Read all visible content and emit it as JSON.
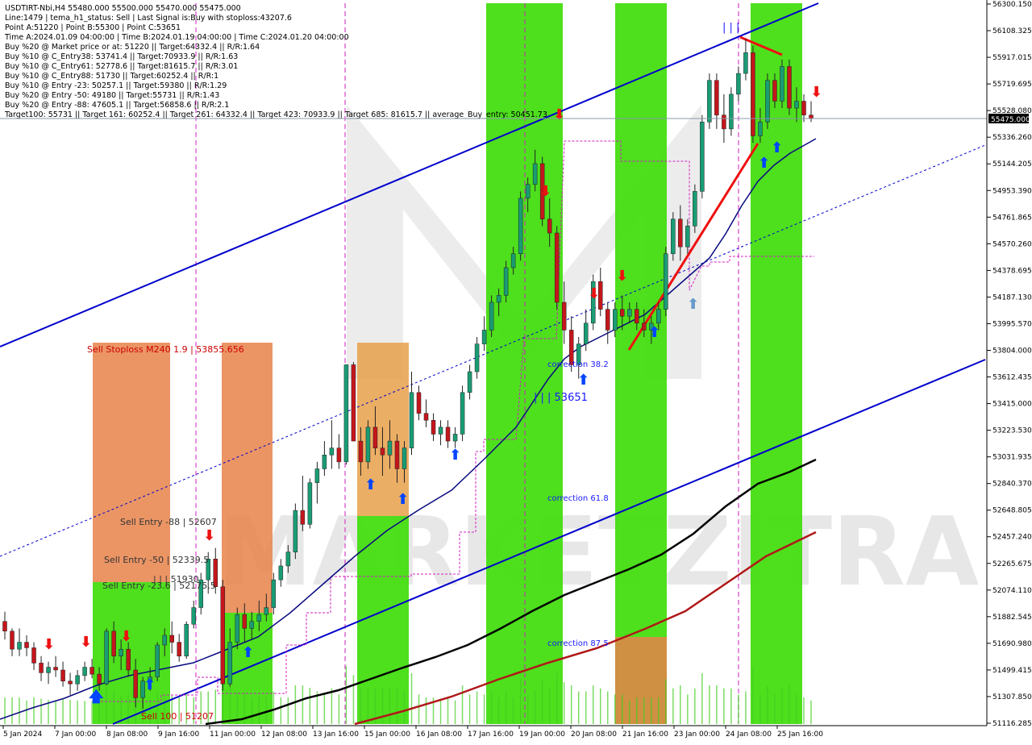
{
  "chart_data": {
    "type": "candlestick",
    "symbol_line": "USDTIRT-Nbi,H4  55480.000 55500.000 55470.000 55475.000",
    "info_lines": [
      "Line:1479 | tema_h1_status: Sell | Last Signal is:Buy with stoploss:43207.6",
      "Point A:51220 | Point B:55300 | Point C:53651",
      "Time A:2024.01.09 04:00:00 | Time B:2024.01.19 04:00:00 | Time C:2024.01.20 04:00:00",
      "Buy %20 @ Market price or at: 51220 || Target:64332.4 || R/R:1.64",
      "Buy %10 @ C_Entry38: 53741.4 || Target:70933.9 || R/R:1.63",
      "Buy %10 @ C_Entry61: 52778.6 || Target:81615.7 || R/R:3.01",
      "Buy %10 @ C_Entry88: 51730 || Target:60252.4 || R/R:1",
      "Buy %10 @ Entry -23: 50257.1 || Target:59380 || R/R:1.29",
      "Buy %20 @ Entry -50: 49180 || Target:55731 || R/R:1.43",
      "Buy %20 @ Entry -88: 47605.1 || Target:56858.6 || R/R:2.1",
      "Target100: 55731 || Target 161: 60252.4 || Target 261: 64332.4 || Target 423: 70933.9 || Target 685: 81615.7 || average_Buy_entry: 50451.73"
    ],
    "y_ticks": [
      "56300.150",
      "56108.325",
      "55917.015",
      "55719.695",
      "55528.080",
      "55336.260",
      "55144.205",
      "54953.390",
      "54761.865",
      "54570.260",
      "54378.695",
      "54187.130",
      "53995.570",
      "53804.000",
      "53612.435",
      "53415.000",
      "53223.530",
      "53031.935",
      "52840.370",
      "52648.805",
      "52457.240",
      "52265.675",
      "52074.110",
      "51882.545",
      "51690.980",
      "51499.415",
      "51307.850",
      "51116.285"
    ],
    "ylim": [
      51116.285,
      56300.15
    ],
    "current_price": "55475.000",
    "x_ticks": [
      "5 Jan 2024",
      "7 Jan 00:00",
      "8 Jan 08:00",
      "9 Jan 16:00",
      "11 Jan 00:00",
      "12 Jan 08:00",
      "13 Jan 16:00",
      "15 Jan 00:00",
      "16 Jan 08:00",
      "17 Jan 16:00",
      "19 Jan 00:00",
      "20 Jan 08:00",
      "21 Jan 16:00",
      "23 Jan 00:00",
      "24 Jan 08:00",
      "25 Jan 16:00"
    ],
    "annotations": {
      "sell_stoploss": "Sell Stoploss M240 1.9 | 53855.656",
      "sell_entry_88": "Sell Entry -88 | 52607",
      "sell_entry_50": "Sell Entry -50 | 52339.5",
      "sell_entry_23": "Sell Entry -23.6 | 52175.5",
      "point_label_low": "| | | 51930",
      "sell_100": "Sell 100 | 51207",
      "correction_38": "correction 38.2",
      "correction_61": "correction 61.8",
      "correction_87": "correction 87.5",
      "point_c": "| | | 53651",
      "point_b": "| | |"
    },
    "watermark": "MARKETZITRADE",
    "colors": {
      "bull": "#1a9c74",
      "bear": "#c4161c",
      "channel": "#0000cc",
      "ma_fast": "#0a0a80",
      "ma_mid": "#000000",
      "ma_slow": "#b01818",
      "green_zone": "#44dd11",
      "orange_zone": "#e8834a",
      "magenta": "#d020c0"
    },
    "candles": [
      [
        51850,
        51920,
        51720,
        51780
      ],
      [
        51780,
        51800,
        51600,
        51650
      ],
      [
        51650,
        51800,
        51600,
        51700
      ],
      [
        51700,
        51750,
        51600,
        51660
      ],
      [
        51660,
        51700,
        51500,
        51550
      ],
      [
        51550,
        51600,
        51420,
        51480
      ],
      [
        51480,
        51560,
        51400,
        51520
      ],
      [
        51520,
        51600,
        51450,
        51500
      ],
      [
        51500,
        51560,
        51380,
        51420
      ],
      [
        51420,
        51480,
        51320,
        51400
      ],
      [
        51400,
        51500,
        51350,
        51460
      ],
      [
        51460,
        51560,
        51420,
        51520
      ],
      [
        51520,
        51580,
        51440,
        51470
      ],
      [
        51470,
        51520,
        51350,
        51400
      ],
      [
        51400,
        51800,
        51390,
        51780
      ],
      [
        51780,
        51850,
        51550,
        51600
      ],
      [
        51600,
        51720,
        51500,
        51650
      ],
      [
        51650,
        51700,
        51450,
        51500
      ],
      [
        51500,
        51580,
        51230,
        51300
      ],
      [
        51300,
        51450,
        51220,
        51420
      ],
      [
        51420,
        51520,
        51350,
        51450
      ],
      [
        51450,
        51700,
        51420,
        51680
      ],
      [
        51680,
        51800,
        51600,
        51750
      ],
      [
        51750,
        51850,
        51620,
        51700
      ],
      [
        51700,
        51760,
        51560,
        51600
      ],
      [
        51600,
        51850,
        51580,
        51830
      ],
      [
        51830,
        52000,
        51800,
        51950
      ],
      [
        51950,
        52200,
        51900,
        52150
      ],
      [
        52150,
        52350,
        52050,
        52300
      ],
      [
        52300,
        52380,
        52050,
        52100
      ],
      [
        52100,
        52150,
        51350,
        51400
      ],
      [
        51400,
        51800,
        51380,
        51700
      ],
      [
        51700,
        51950,
        51650,
        51900
      ],
      [
        51900,
        51980,
        51700,
        51800
      ],
      [
        51800,
        51920,
        51720,
        51850
      ],
      [
        51850,
        52000,
        51780,
        51900
      ],
      [
        51900,
        52050,
        51850,
        51950
      ],
      [
        51950,
        52200,
        51900,
        52150
      ],
      [
        52150,
        52300,
        52100,
        52250
      ],
      [
        52250,
        52400,
        52200,
        52350
      ],
      [
        52350,
        52700,
        52300,
        52650
      ],
      [
        52650,
        52900,
        52500,
        52550
      ],
      [
        52550,
        52880,
        52520,
        52850
      ],
      [
        52850,
        53000,
        52700,
        52950
      ],
      [
        52950,
        53150,
        52900,
        53050
      ],
      [
        53050,
        53300,
        52950,
        53100
      ],
      [
        53100,
        53200,
        52950,
        53000
      ],
      [
        53000,
        53700,
        52980,
        53700
      ],
      [
        53700,
        53720,
        53150,
        53150
      ],
      [
        53150,
        53250,
        52900,
        53000
      ],
      [
        53000,
        53300,
        52950,
        53250
      ],
      [
        53250,
        53400,
        53050,
        53100
      ],
      [
        53100,
        53250,
        52900,
        53050
      ],
      [
        53050,
        53300,
        52950,
        53150
      ],
      [
        53150,
        53200,
        52850,
        52950
      ],
      [
        52950,
        53150,
        52850,
        53100
      ],
      [
        53100,
        53650,
        53050,
        53500
      ],
      [
        53500,
        53550,
        53300,
        53350
      ],
      [
        53350,
        53450,
        53250,
        53300
      ],
      [
        53300,
        53350,
        53150,
        53200
      ],
      [
        53200,
        53300,
        53120,
        53250
      ],
      [
        53250,
        53300,
        53100,
        53150
      ],
      [
        53150,
        53250,
        53100,
        53200
      ],
      [
        53200,
        53550,
        53150,
        53500
      ],
      [
        53500,
        53700,
        53450,
        53650
      ],
      [
        53650,
        53900,
        53600,
        53850
      ],
      [
        53850,
        54050,
        53800,
        53950
      ],
      [
        53950,
        54200,
        53900,
        54150
      ],
      [
        54150,
        54250,
        54050,
        54200
      ],
      [
        54200,
        54450,
        54150,
        54400
      ],
      [
        54400,
        54550,
        54350,
        54500
      ],
      [
        54500,
        54950,
        54450,
        54900
      ],
      [
        54900,
        55050,
        54800,
        55000
      ],
      [
        55000,
        55250,
        54950,
        55150
      ],
      [
        55150,
        55200,
        54700,
        54750
      ],
      [
        54750,
        54900,
        54550,
        54650
      ],
      [
        54650,
        54700,
        54100,
        54150
      ],
      [
        54150,
        54300,
        53850,
        53950
      ],
      [
        53950,
        54050,
        53650,
        53700
      ],
      [
        53700,
        53900,
        53600,
        53850
      ],
      [
        53850,
        54100,
        53800,
        54000
      ],
      [
        54000,
        54350,
        53950,
        54300
      ],
      [
        54300,
        54400,
        54050,
        54100
      ],
      [
        54100,
        54150,
        53850,
        53950
      ],
      [
        53950,
        54150,
        53900,
        54100
      ],
      [
        54100,
        54200,
        53950,
        54050
      ],
      [
        54050,
        54150,
        54000,
        54100
      ],
      [
        54100,
        54150,
        53950,
        54000
      ],
      [
        54000,
        54100,
        53900,
        53950
      ],
      [
        53950,
        54050,
        53850,
        54000
      ],
      [
        54000,
        54150,
        53950,
        54100
      ],
      [
        54100,
        54550,
        54050,
        54500
      ],
      [
        54500,
        54800,
        54450,
        54750
      ],
      [
        54750,
        54850,
        54450,
        54550
      ],
      [
        54550,
        54750,
        54500,
        54700
      ],
      [
        54700,
        55000,
        54650,
        54950
      ],
      [
        54950,
        55500,
        54900,
        55450
      ],
      [
        55450,
        55800,
        55400,
        55750
      ],
      [
        55750,
        55800,
        55400,
        55500
      ],
      [
        55500,
        55650,
        55300,
        55400
      ],
      [
        55400,
        55700,
        55350,
        55650
      ],
      [
        55650,
        55850,
        55600,
        55800
      ],
      [
        55800,
        56050,
        55750,
        55950
      ],
      [
        55950,
        56000,
        55300,
        55350
      ],
      [
        55350,
        55550,
        55300,
        55450
      ],
      [
        55450,
        55800,
        55400,
        55750
      ],
      [
        55750,
        55800,
        55550,
        55600
      ],
      [
        55600,
        55900,
        55550,
        55850
      ],
      [
        55850,
        55900,
        55500,
        55550
      ],
      [
        55550,
        55700,
        55450,
        55600
      ],
      [
        55600,
        55650,
        55450,
        55500
      ],
      [
        55500,
        55600,
        55450,
        55475
      ]
    ]
  }
}
